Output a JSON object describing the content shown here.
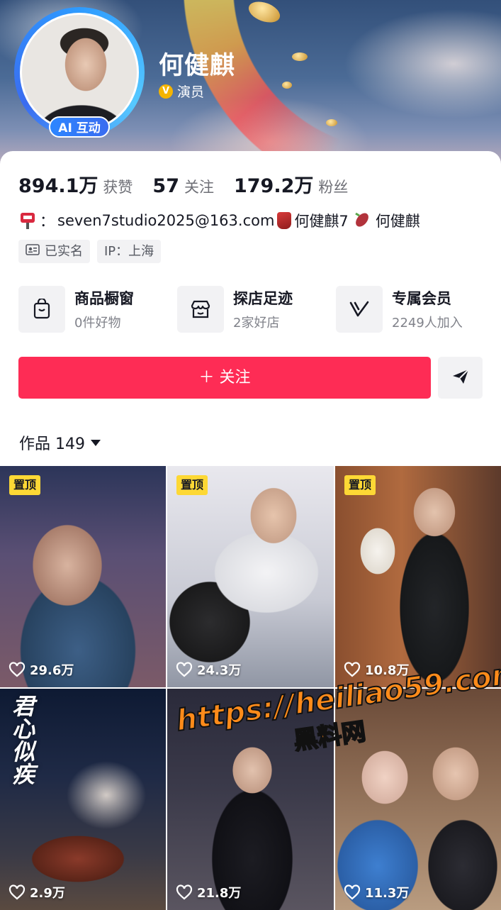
{
  "profile": {
    "name": "何健麒",
    "verified_title": "演员",
    "ai_badge": "AI 互动"
  },
  "stats": [
    {
      "value": "894.1万",
      "label": "获赞"
    },
    {
      "value": "57",
      "label": "关注"
    },
    {
      "value": "179.2万",
      "label": "粉丝"
    }
  ],
  "contact": {
    "colon": "：",
    "email": "seven7studio2025@163.com",
    "handle1": "何健麒7",
    "handle2": "何健麒"
  },
  "tags": {
    "realname": "已实名",
    "ip": "IP：上海"
  },
  "shops": [
    {
      "title": "商品橱窗",
      "subtitle": "0件好物",
      "icon": "bag-icon"
    },
    {
      "title": "探店足迹",
      "subtitle": "2家好店",
      "icon": "store-icon"
    },
    {
      "title": "专属会员",
      "subtitle": "2249人加入",
      "icon": "vip-v-icon"
    }
  ],
  "actions": {
    "follow": "＋ 关注"
  },
  "works": {
    "label": "作品 149"
  },
  "videos": [
    {
      "pinned": "置顶",
      "likes": "29.6万"
    },
    {
      "pinned": "置顶",
      "likes": "24.3万"
    },
    {
      "pinned": "置顶",
      "likes": "10.8万"
    },
    {
      "poster_title": "君心似疾",
      "likes": "2.9万"
    },
    {
      "likes": "21.8万"
    },
    {
      "likes": "11.3万"
    }
  ],
  "watermark": {
    "url": "https://heiliao59.com",
    "name": "黑料网"
  },
  "colors": {
    "follow": "#fe2c55",
    "pin": "#fdd835",
    "accent_ring": "#2e9bff"
  }
}
